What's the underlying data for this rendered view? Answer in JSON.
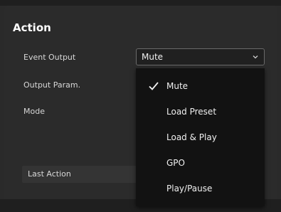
{
  "section": {
    "title": "Action"
  },
  "rows": {
    "event_output_label": "Event Output",
    "output_param_label": "Output Param.",
    "mode_label": "Mode",
    "last_action_label": "Last Action"
  },
  "event_output": {
    "selected": "Mute",
    "chevron_icon": "chevron-down-icon"
  },
  "menu": {
    "items": [
      {
        "label": "Mute",
        "checked": true
      },
      {
        "label": "Load Preset",
        "checked": false
      },
      {
        "label": "Load & Play",
        "checked": false
      },
      {
        "label": "GPO",
        "checked": false
      },
      {
        "label": "Play/Pause",
        "checked": false
      }
    ],
    "check_icon": "check-icon"
  },
  "colors": {
    "panel_bg": "#2b2b2b",
    "menu_bg": "#121212",
    "text": "#f0f0f0"
  }
}
